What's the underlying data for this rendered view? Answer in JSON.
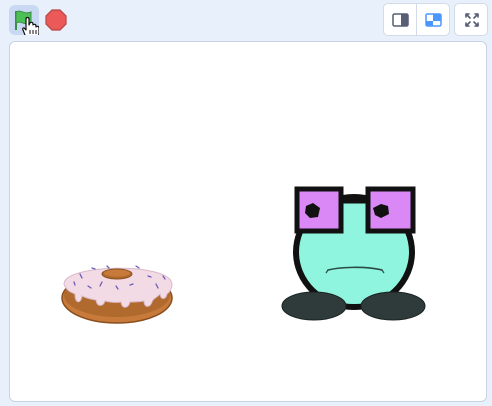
{
  "toolbar": {
    "green_flag": {
      "icon": "green-flag-icon",
      "color": "#4cbf56",
      "active": true
    },
    "stop": {
      "icon": "stop-icon",
      "color": "#ec5959"
    },
    "layout_modes": [
      {
        "icon": "small-stage-icon",
        "selected": false
      },
      {
        "icon": "normal-stage-icon",
        "selected": true
      }
    ],
    "fullscreen": {
      "icon": "fullscreen-icon"
    }
  },
  "stage": {
    "background": "#ffffff",
    "sprites": [
      {
        "name": "donut",
        "colors": {
          "dough": "#c87a3a",
          "frosting": "#f3dbe6"
        }
      },
      {
        "name": "character",
        "colors": {
          "body": "#8ff5de",
          "glasses": "#d988f5",
          "outline": "#111111",
          "feet": "#2f3a3a"
        }
      }
    ]
  }
}
